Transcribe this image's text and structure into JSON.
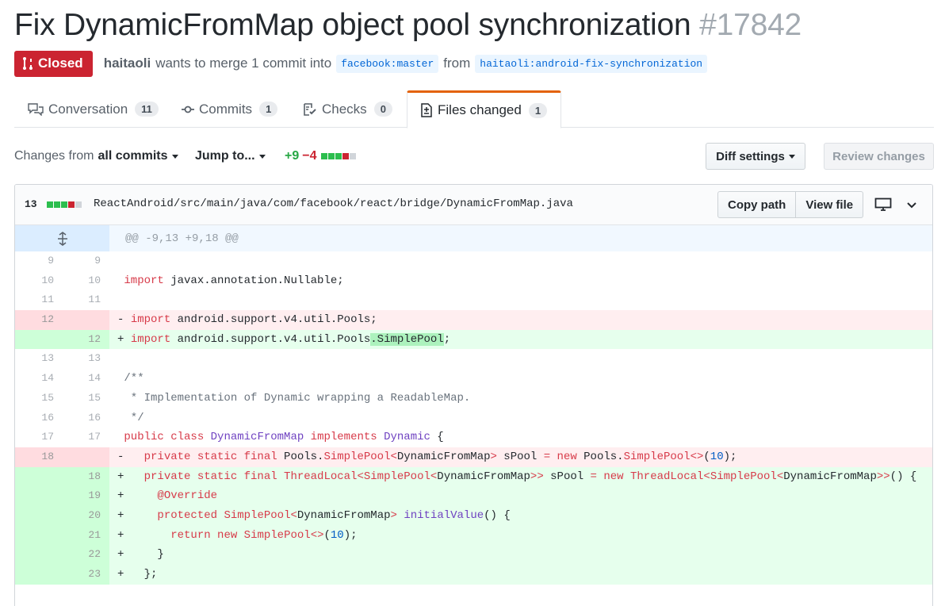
{
  "pr": {
    "title": "Fix DynamicFromMap object pool synchronization",
    "number": "#17842",
    "state": "Closed",
    "author": "haitaoli",
    "action_text": "wants to merge 1 commit into",
    "base_branch": "facebook:master",
    "from_text": "from",
    "head_branch": "haitaoli:android-fix-synchronization"
  },
  "tabs": [
    {
      "label": "Conversation",
      "count": "11"
    },
    {
      "label": "Commits",
      "count": "1"
    },
    {
      "label": "Checks",
      "count": "0"
    },
    {
      "label": "Files changed",
      "count": "1"
    }
  ],
  "toolbar": {
    "changes_from_label": "Changes from",
    "changes_from_value": "all commits",
    "jump_to": "Jump to...",
    "additions": "+9",
    "deletions": "−4",
    "diff_settings": "Diff settings",
    "review_changes": "Review changes"
  },
  "file": {
    "change_count": "13",
    "path": "ReactAndroid/src/main/java/com/facebook/react/bridge/DynamicFromMap.java",
    "copy_path": "Copy path",
    "view_file": "View file",
    "hunk_header": "@@ -9,13 +9,18 @@"
  },
  "diff_lines": [
    {
      "type": "ctx",
      "old": "9",
      "new": "9"
    },
    {
      "type": "ctx",
      "old": "10",
      "new": "10"
    },
    {
      "type": "ctx",
      "old": "11",
      "new": "11"
    },
    {
      "type": "rem",
      "old": "12",
      "new": ""
    },
    {
      "type": "add",
      "old": "",
      "new": "12"
    },
    {
      "type": "ctx",
      "old": "13",
      "new": "13"
    },
    {
      "type": "ctx",
      "old": "14",
      "new": "14"
    },
    {
      "type": "ctx",
      "old": "15",
      "new": "15"
    },
    {
      "type": "ctx",
      "old": "16",
      "new": "16"
    },
    {
      "type": "ctx",
      "old": "17",
      "new": "17"
    },
    {
      "type": "rem",
      "old": "18",
      "new": ""
    },
    {
      "type": "add",
      "old": "",
      "new": "18"
    },
    {
      "type": "add",
      "old": "",
      "new": "19"
    },
    {
      "type": "add",
      "old": "",
      "new": "20"
    },
    {
      "type": "add",
      "old": "",
      "new": "21"
    },
    {
      "type": "add",
      "old": "",
      "new": "22"
    },
    {
      "type": "add",
      "old": "",
      "new": "23"
    }
  ],
  "code": {
    "l1": "",
    "l2": [
      " ",
      {
        "k": "import"
      },
      " javax.annotation.Nullable;"
    ],
    "l3": "",
    "l4": [
      "- ",
      {
        "k": "import"
      },
      " android.support.v4.util.Pools;"
    ],
    "l5": [
      "+ ",
      {
        "k": "import"
      },
      " android.support.v4.util.Pools",
      {
        "hl": ".SimplePool"
      },
      ";"
    ],
    "l6": "",
    "l7": [
      " ",
      {
        "c": "/**"
      }
    ],
    "l8": [
      " ",
      {
        "c": " * Implementation of Dynamic wrapping a ReadableMap."
      }
    ],
    "l9": [
      " ",
      {
        "c": " */"
      }
    ],
    "l10": [
      " ",
      {
        "k": "public class"
      },
      " ",
      {
        "t": "DynamicFromMap"
      },
      " ",
      {
        "k": "implements"
      },
      " ",
      {
        "t": "Dynamic"
      },
      " {"
    ],
    "l11": [
      "-   ",
      {
        "k": "private static final"
      },
      " Pools.",
      {
        "k": "SimplePool"
      },
      {
        "k": "<"
      },
      "DynamicFromMap",
      {
        "k": ">"
      },
      " sPool ",
      {
        "k": "="
      },
      " ",
      {
        "k": "new"
      },
      " Pools.",
      {
        "k": "SimplePool"
      },
      {
        "k": "<>"
      },
      "(",
      {
        "n": "10"
      },
      ");"
    ],
    "l12": [
      "+   ",
      {
        "k": "private static final"
      },
      " ",
      {
        "k": "ThreadLocal"
      },
      {
        "k": "<"
      },
      {
        "k": "SimplePool"
      },
      {
        "k": "<"
      },
      "DynamicFromMap",
      {
        "k": ">>"
      },
      " sPool ",
      {
        "k": "="
      },
      " ",
      {
        "k": "new"
      },
      " ",
      {
        "k": "ThreadLocal"
      },
      {
        "k": "<"
      },
      {
        "k": "SimplePool"
      },
      {
        "k": "<"
      },
      "DynamicFromMap",
      {
        "k": ">>"
      },
      "() {"
    ],
    "l13": [
      "+     ",
      {
        "k": "@Override"
      }
    ],
    "l14": [
      "+     ",
      {
        "k": "protected"
      },
      " ",
      {
        "k": "SimplePool"
      },
      {
        "k": "<"
      },
      "DynamicFromMap",
      {
        "k": ">"
      },
      " ",
      {
        "t": "initialValue"
      },
      "() {"
    ],
    "l15": [
      "+       ",
      {
        "k": "return"
      },
      " ",
      {
        "k": "new"
      },
      " ",
      {
        "k": "SimplePool"
      },
      {
        "k": "<>"
      },
      "(",
      {
        "n": "10"
      },
      ");"
    ],
    "l16": [
      "+     }"
    ],
    "l17": [
      "+   };"
    ]
  }
}
